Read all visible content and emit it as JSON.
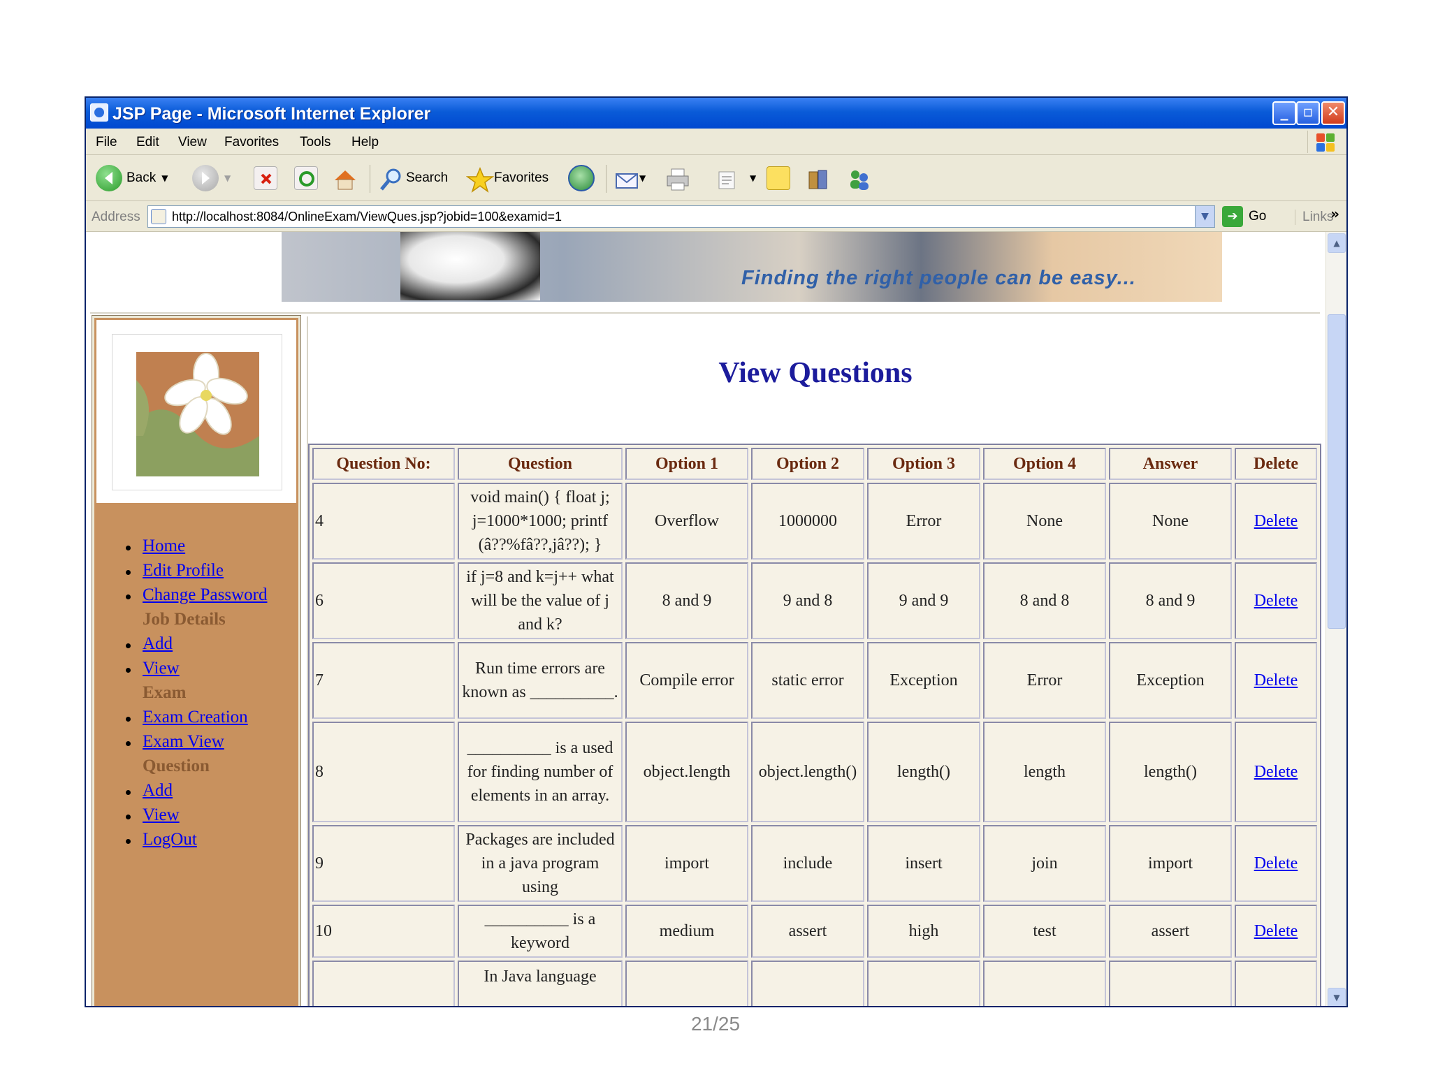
{
  "window": {
    "title": "JSP Page - Microsoft Internet Explorer",
    "minimize": "_",
    "maximize": "▫",
    "close": "✕"
  },
  "menu": [
    "File",
    "Edit",
    "View",
    "Favorites",
    "Tools",
    "Help"
  ],
  "toolbar": {
    "back_label": "Back",
    "search_label": "Search",
    "favorites_label": "Favorites"
  },
  "address": {
    "label": "Address",
    "url": "http://localhost:8084/OnlineExam/ViewQues.jsp?jobid=100&examid=1",
    "go_label": "Go",
    "links_label": "Links",
    "links_chevron": "»"
  },
  "banner": {
    "tagline": "Finding the right people can be easy..."
  },
  "nav": [
    {
      "type": "link",
      "label": "Home"
    },
    {
      "type": "link",
      "label": "Edit Profile"
    },
    {
      "type": "link",
      "label": "Change Password"
    },
    {
      "type": "section",
      "label": "Job Details"
    },
    {
      "type": "link",
      "label": "Add"
    },
    {
      "type": "link",
      "label": "View"
    },
    {
      "type": "section",
      "label": "Exam"
    },
    {
      "type": "link",
      "label": "Exam Creation"
    },
    {
      "type": "link",
      "label": "Exam View"
    },
    {
      "type": "section",
      "label": "Question"
    },
    {
      "type": "link",
      "label": "Add"
    },
    {
      "type": "link",
      "label": "View"
    },
    {
      "type": "link",
      "label": "LogOut"
    }
  ],
  "page": {
    "title": "View Questions"
  },
  "table": {
    "headers": [
      "Question No:",
      "Question",
      "Option 1",
      "Option 2",
      "Option 3",
      "Option 4",
      "Answer",
      "Delete"
    ],
    "rows": [
      {
        "no": "4",
        "question": "void main() { float j; j=1000*1000; printf (â??%fâ??,jâ??); }",
        "o1": "Overflow",
        "o2": "1000000",
        "o3": "Error",
        "o4": "None",
        "answer": "None",
        "delete": "Delete"
      },
      {
        "no": "6",
        "question": "if j=8 and k=j++ what will be the value of j and k?",
        "o1": "8 and 9",
        "o2": "9 and 8",
        "o3": "9 and 9",
        "o4": "8 and 8",
        "answer": "8 and 9",
        "delete": "Delete"
      },
      {
        "no": "7",
        "question": "Run time errors are known as __________.",
        "o1": "Compile error",
        "o2": "static error",
        "o3": "Exception",
        "o4": "Error",
        "answer": "Exception",
        "delete": "Delete"
      },
      {
        "no": "8",
        "question": "__________ is a used for finding number of elements in an array.",
        "o1": "object.length",
        "o2": "object.length()",
        "o3": "length()",
        "o4": "length",
        "answer": "length()",
        "delete": "Delete"
      },
      {
        "no": "9",
        "question": "Packages are included in a java program using",
        "o1": "import",
        "o2": "include",
        "o3": "insert",
        "o4": "join",
        "answer": "import",
        "delete": "Delete"
      },
      {
        "no": "10",
        "question": "__________ is a keyword",
        "o1": "medium",
        "o2": "assert",
        "o3": "high",
        "o4": "test",
        "answer": "assert",
        "delete": "Delete"
      },
      {
        "no": "",
        "question": "In Java language",
        "o1": "",
        "o2": "",
        "o3": "",
        "o4": "",
        "answer": "",
        "delete": ""
      }
    ]
  },
  "slide": {
    "page_number": "21/25"
  }
}
